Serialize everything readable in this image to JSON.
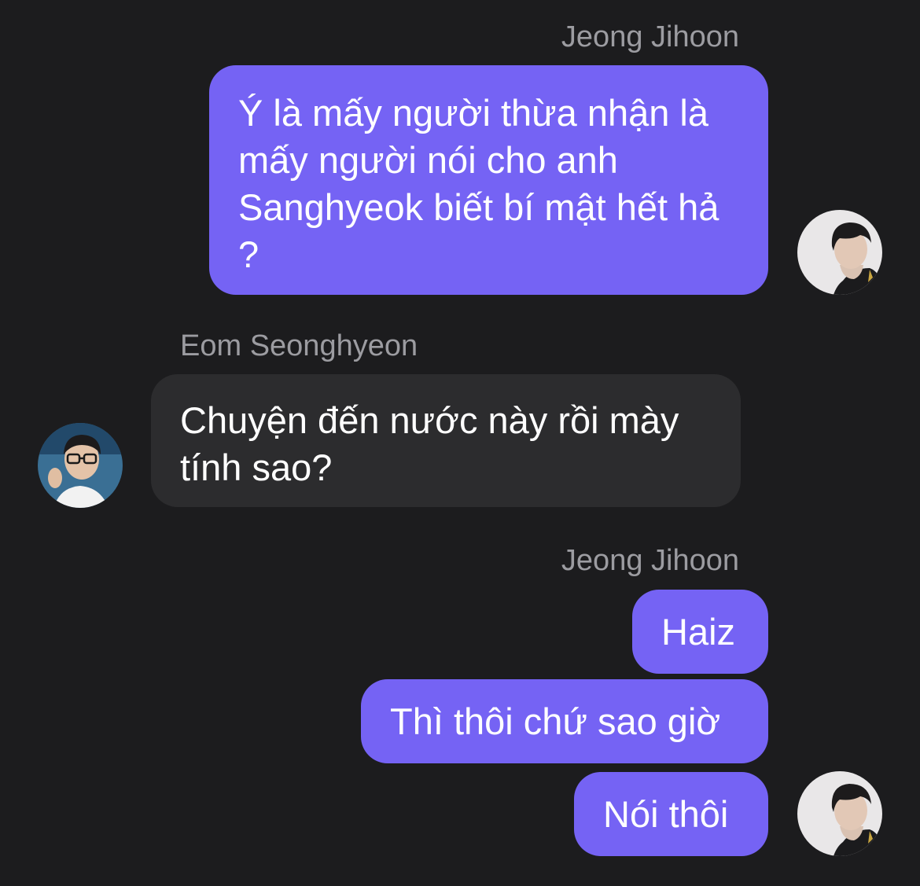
{
  "messages": {
    "group1": {
      "sender": "Jeong Jihoon",
      "bubble1": "Ý là mấy người thừa nhận là mấy người nói cho anh Sanghyeok biết bí mật hết hả ?",
      "avatar_icon": "avatar-jeong-jihoon"
    },
    "group2": {
      "sender": "Eom Seonghyeon",
      "bubble1": "Chuyện đến nước này rồi mày tính sao?",
      "avatar_icon": "avatar-eom-seonghyeon"
    },
    "group3": {
      "sender": "Jeong Jihoon",
      "bubble1": "Haiz",
      "bubble2": "Thì thôi chứ sao giờ",
      "bubble3": "Nói thôi",
      "avatar_icon": "avatar-jeong-jihoon"
    }
  },
  "colors": {
    "background": "#1c1c1e",
    "outgoing_bubble": "#7563f4",
    "incoming_bubble": "#2c2c2e",
    "sender_name": "#9c9ca1"
  }
}
